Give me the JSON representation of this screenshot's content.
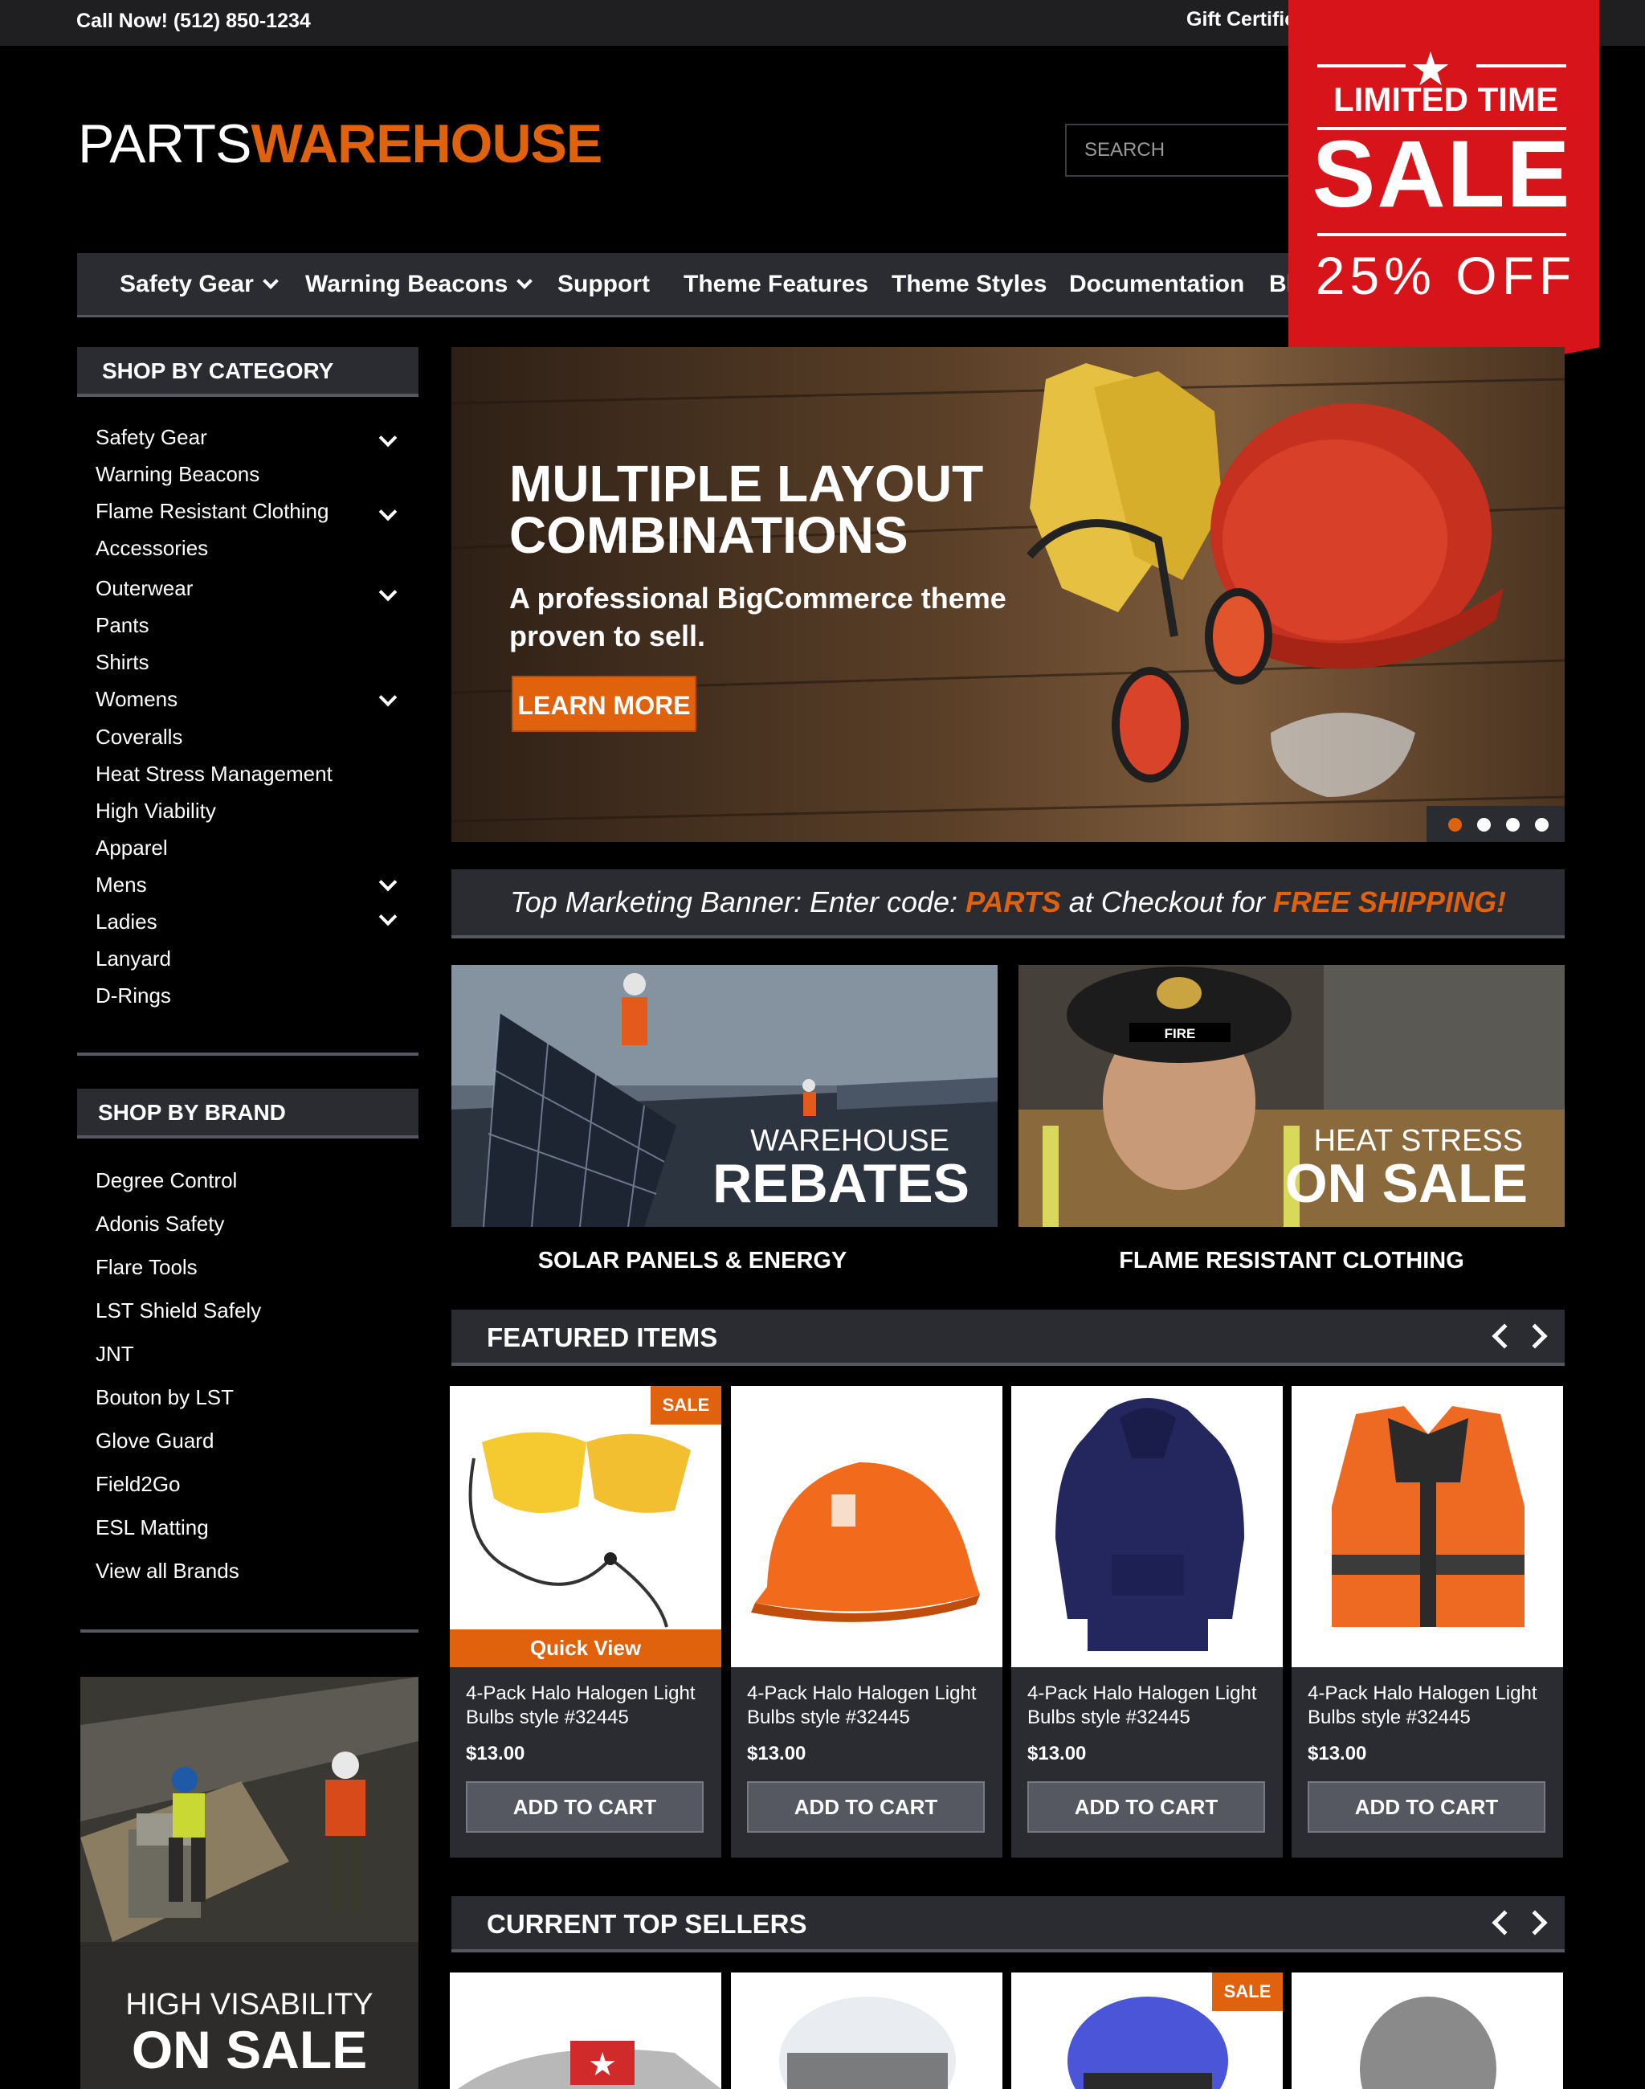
{
  "topbar": {
    "phone": "Call Now! (512) 850-1234",
    "gift": "Gift Certifica"
  },
  "logo": {
    "part1": "PARTS",
    "part2": "WAREHOUSE"
  },
  "search": {
    "placeholder": "SEARCH"
  },
  "nav": {
    "items": [
      "Safety Gear",
      "Warning Beacons",
      "Support",
      "Theme Features",
      "Theme Styles",
      "Documentation",
      "Bl"
    ]
  },
  "ribbon": {
    "limited": "LIMITED TIME",
    "sale": "SALE",
    "off": "25% OFF"
  },
  "sidebar": {
    "category_title": "SHOP BY CATEGORY",
    "categories": [
      "Safety Gear",
      "Warning Beacons",
      "Flame Resistant Clothing",
      "Accessories",
      "Outerwear",
      "Pants",
      "Shirts",
      "Womens",
      "Coveralls",
      "Heat Stress Management",
      "High Viability",
      "Apparel",
      "Mens",
      "Ladies",
      "Lanyard",
      "D-Rings"
    ],
    "brand_title": "SHOP BY BRAND",
    "brands": [
      "Degree Control",
      "Adonis Safety",
      "Flare Tools",
      "LST Shield Safely",
      "JNT",
      "Bouton by LST",
      "Glove Guard",
      "Field2Go",
      "ESL Matting",
      "View all Brands"
    ],
    "promo_small": "HIGH VISABILITY",
    "promo_big": "ON SALE"
  },
  "hero": {
    "title_line1": "MULTIPLE LAYOUT",
    "title_line2": "COMBINATIONS",
    "subtitle_line1": "A professional BigCommerce theme",
    "subtitle_line2": "proven to sell.",
    "button": "LEARN MORE",
    "active_slide": 1,
    "slide_count": 4
  },
  "marketing": {
    "part1": "Top Marketing Banner: Enter code: ",
    "code": "PARTS",
    "part2": " at Checkout for ",
    "offer": "FREE SHIPPING!"
  },
  "promos": [
    {
      "small": "WAREHOUSE",
      "big": "REBATES",
      "caption": "SOLAR PANELS  & ENERGY"
    },
    {
      "small": "HEAT STRESS",
      "big": "ON SALE",
      "caption": "FLAME RESISTANT CLOTHING",
      "helmet_label": "FIRE"
    }
  ],
  "featured": {
    "title": "FEATURED ITEMS",
    "sale_label": "SALE",
    "quick_view": "Quick View",
    "products": [
      {
        "name": "4-Pack Halo Halogen Light Bulbs style #32445",
        "price": "$13.00",
        "button": "ADD TO CART"
      },
      {
        "name": "4-Pack Halo Halogen Light Bulbs style #32445",
        "price": "$13.00",
        "button": "ADD TO CART"
      },
      {
        "name": "4-Pack Halo Halogen Light Bulbs style #32445",
        "price": "$13.00",
        "button": "ADD TO CART"
      },
      {
        "name": "4-Pack Halo Halogen Light Bulbs style #32445",
        "price": "$13.00",
        "button": "ADD TO CART"
      }
    ]
  },
  "top_sellers": {
    "title": "CURRENT TOP SELLERS",
    "sale_label": "SALE"
  },
  "colors": {
    "accent": "#e0620c",
    "panel": "#2a2c31",
    "ribbon": "#d8141b"
  }
}
